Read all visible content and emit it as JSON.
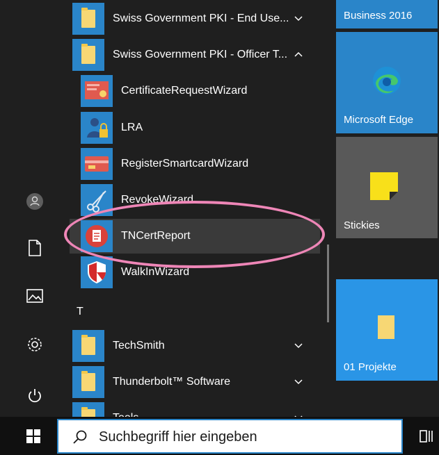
{
  "app_list": {
    "items": [
      {
        "label": "Swiss Government PKI - End Use...",
        "icon": "folder-icon",
        "expanded": false
      },
      {
        "label": "Swiss Government PKI - Officer T...",
        "icon": "folder-icon",
        "expanded": true
      },
      {
        "label": "CertificateRequestWizard",
        "icon": "certificate-icon"
      },
      {
        "label": "LRA",
        "icon": "lra-user-lock-icon"
      },
      {
        "label": "RegisterSmartcardWizard",
        "icon": "smartcard-icon"
      },
      {
        "label": "RevokeWizard",
        "icon": "scissors-icon"
      },
      {
        "label": "TNCertReport",
        "icon": "report-icon",
        "highlighted": true
      },
      {
        "label": "WalkInWizard",
        "icon": "shield-icon"
      }
    ],
    "section_letter": "T",
    "t_items": [
      {
        "label": "TechSmith",
        "icon": "folder-icon"
      },
      {
        "label": "Thunderbolt™ Software",
        "icon": "folder-icon"
      },
      {
        "label": "Tools",
        "icon": "folder-icon"
      }
    ]
  },
  "tiles": [
    {
      "name": "Business 2016"
    },
    {
      "name": "Microsoft Edge",
      "icon": "edge-icon"
    },
    {
      "name": "Stickies",
      "icon": "stickies-icon"
    },
    {
      "name": "01 Projekte",
      "icon": "folder-icon"
    }
  ],
  "search": {
    "placeholder": "Suchbegriff hier eingeben"
  },
  "colors": {
    "accent": "#2a85c9",
    "annotation": "#ee86b7",
    "background": "#1f1f1f"
  }
}
